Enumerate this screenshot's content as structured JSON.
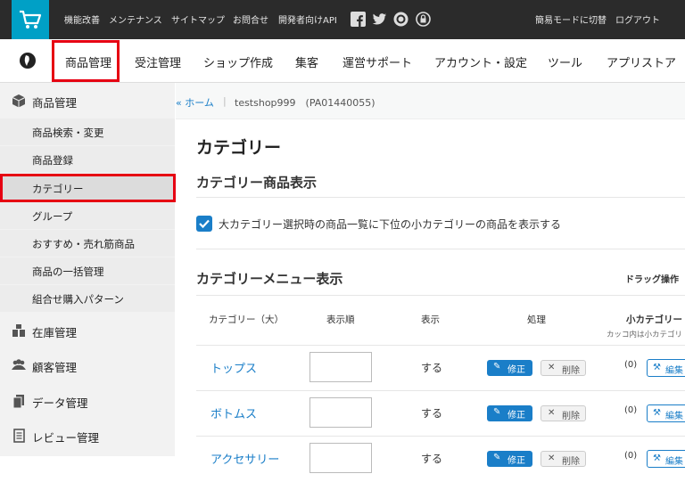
{
  "topbar": {
    "links": [
      "機能改善",
      "メンテナンス",
      "サイトマップ",
      "お問合せ",
      "開発者向けAPI"
    ],
    "right_links": [
      "簡易モードに切替",
      "ログアウト"
    ],
    "social_icons": [
      "facebook-icon",
      "twitter-icon",
      "blog-icon",
      "support-icon"
    ]
  },
  "nav": {
    "items": [
      "商品管理",
      "受注管理",
      "ショップ作成",
      "集客",
      "運営サポート",
      "アカウント・設定",
      "ツール",
      "アプリストア"
    ]
  },
  "sidebar": {
    "groups": [
      {
        "label": "商品管理",
        "icon": "box-icon"
      },
      {
        "label": "在庫管理",
        "icon": "warehouse-icon"
      },
      {
        "label": "顧客管理",
        "icon": "users-icon"
      },
      {
        "label": "データ管理",
        "icon": "files-icon"
      },
      {
        "label": "レビュー管理",
        "icon": "document-icon"
      }
    ],
    "sub_items": [
      "商品検索・変更",
      "商品登録",
      "カテゴリー",
      "グループ",
      "おすすめ・売れ筋商品",
      "商品の一括管理",
      "組合せ購入パターン"
    ],
    "active_sub": "カテゴリー"
  },
  "breadcrumb": {
    "home": "« ホーム",
    "separator": "|",
    "shop": "testshop999　(PA01440055)"
  },
  "page": {
    "title": "カテゴリー",
    "section1_title": "カテゴリー商品表示",
    "checkbox_label": "大カテゴリー選択時の商品一覧に下位の小カテゴリーの商品を表示する",
    "checkbox_checked": true,
    "section2_title": "カテゴリーメニュー表示",
    "drag_label": "ドラッグ操作"
  },
  "table": {
    "headers": {
      "category": "カテゴリー（大）",
      "order": "表示順",
      "display": "表示",
      "action": "処理",
      "sub": "小カテゴリー",
      "sub_note": "カッコ内は小カテゴリ"
    },
    "rows": [
      {
        "name": "トップス",
        "display": "する",
        "edit": "修正",
        "delete": "削除",
        "count": "(0)",
        "sub_button": "編集"
      },
      {
        "name": "ボトムス",
        "display": "する",
        "edit": "修正",
        "delete": "削除",
        "count": "(0)",
        "sub_button": "編集"
      },
      {
        "name": "アクセサリー",
        "display": "する",
        "edit": "修正",
        "delete": "削除",
        "count": "(0)",
        "sub_button": "編集"
      }
    ]
  },
  "colors": {
    "accent": "#1a7ec8",
    "highlight": "#e60012",
    "topbar": "#2b2b2b",
    "cart": "#00a0c6"
  }
}
